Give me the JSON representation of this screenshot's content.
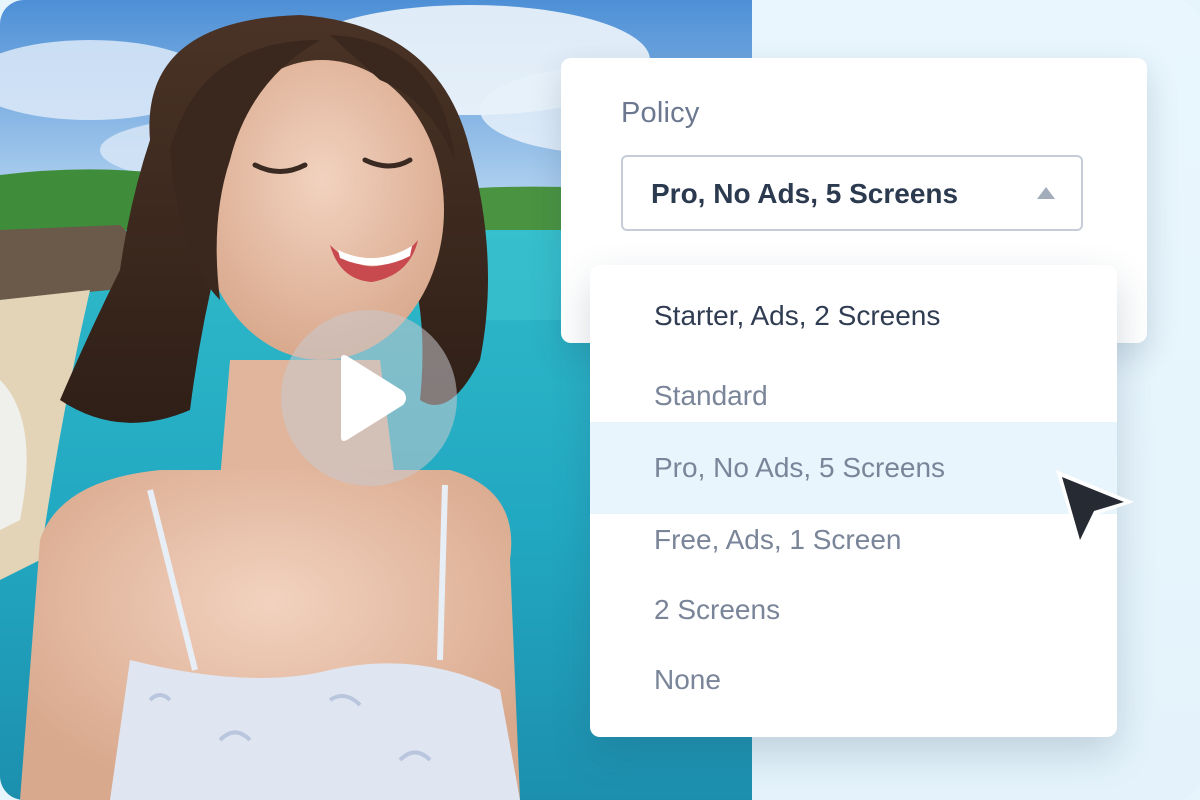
{
  "policy": {
    "label": "Policy",
    "selected_value": "Pro, No Ads, 5 Screens"
  },
  "dropdown": {
    "options": [
      "Starter, Ads, 2 Screens",
      "Standard",
      "Pro, No Ads, 5 Screens",
      "Free, Ads, 1 Screen",
      "2 Screens",
      "None"
    ],
    "hovered_option": "Pro, No Ads, 5 Screens"
  },
  "icons": {
    "play": "play-icon",
    "caret": "caret-up-icon",
    "cursor": "mouse-pointer-icon"
  },
  "colors": {
    "accent_bg": "#e6f4fc",
    "hover_bg": "#e8f5fd",
    "text_dark": "#2c3a50",
    "text_muted": "#7a8599"
  }
}
